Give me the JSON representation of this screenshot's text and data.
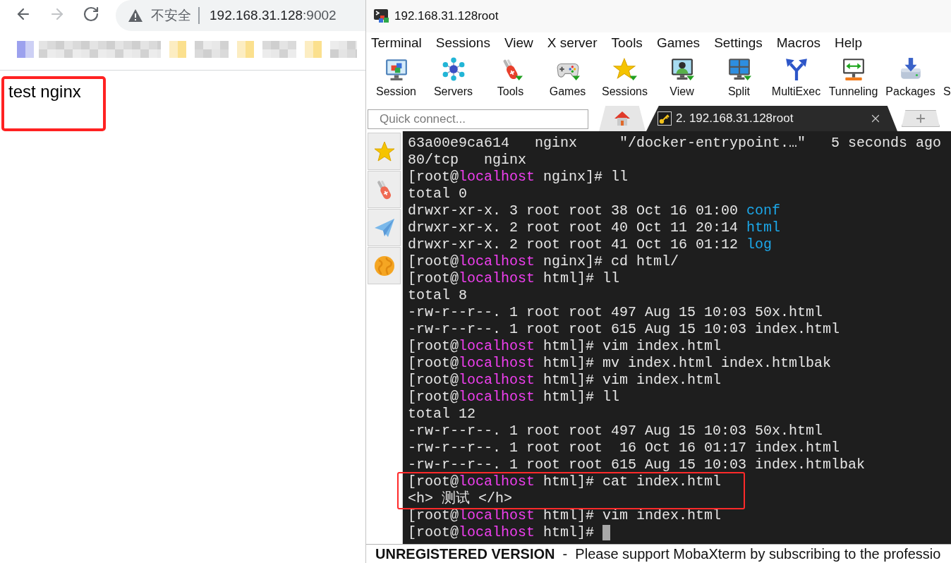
{
  "browser": {
    "nav_buttons": [
      {
        "disabled": false
      },
      {
        "disabled": true
      },
      {
        "disabled": false
      }
    ],
    "address_bar": {
      "security_label": "不安全",
      "host": "192.168.31.128",
      "port": ":9002"
    },
    "page": {
      "text": "test nginx"
    }
  },
  "terminal_app": {
    "window": {
      "title": "192.168.31.128root"
    },
    "menu": [
      "Terminal",
      "Sessions",
      "View",
      "X server",
      "Tools",
      "Games",
      "Settings",
      "Macros",
      "Help"
    ],
    "toolbar": [
      {
        "label": "Session"
      },
      {
        "label": "Servers"
      },
      {
        "label": "Tools"
      },
      {
        "label": "Games"
      },
      {
        "label": "Sessions"
      },
      {
        "label": "View"
      },
      {
        "label": "Split"
      },
      {
        "label": "MultiExec"
      },
      {
        "label": "Tunneling"
      },
      {
        "label": "Packages"
      },
      {
        "label": "S"
      }
    ],
    "quick_connect": {
      "placeholder": "Quick connect..."
    },
    "tabs": [
      {
        "kind": "home",
        "selected": false
      },
      {
        "kind": "session",
        "label": "2. 192.168.31.128root",
        "selected": true
      }
    ],
    "terminal": {
      "cursor": true,
      "lines": [
        [
          {
            "text": "63a00e9ca614   nginx     \"/docker-entrypoint.…\"   5 seconds ago"
          }
        ],
        [
          {
            "text": "80/tcp   nginx"
          }
        ],
        [
          {
            "text": "[root@"
          },
          {
            "text": "localhost",
            "kind": "host"
          },
          {
            "text": " nginx]# ll"
          }
        ],
        [
          {
            "text": "total 0"
          }
        ],
        [
          {
            "text": "drwxr-xr-x. 3 root root 38 Oct 16 01:00 "
          },
          {
            "text": "conf",
            "kind": "dir"
          }
        ],
        [
          {
            "text": "drwxr-xr-x. 2 root root 40 Oct 11 20:14 "
          },
          {
            "text": "html",
            "kind": "dir"
          }
        ],
        [
          {
            "text": "drwxr-xr-x. 2 root root 41 Oct 16 01:12 "
          },
          {
            "text": "log",
            "kind": "dir"
          }
        ],
        [
          {
            "text": "[root@"
          },
          {
            "text": "localhost",
            "kind": "host"
          },
          {
            "text": " nginx]# cd html/"
          }
        ],
        [
          {
            "text": "[root@"
          },
          {
            "text": "localhost",
            "kind": "host"
          },
          {
            "text": " html]# ll"
          }
        ],
        [
          {
            "text": "total 8"
          }
        ],
        [
          {
            "text": "-rw-r--r--. 1 root root 497 Aug 15 10:03 50x.html"
          }
        ],
        [
          {
            "text": "-rw-r--r--. 1 root root 615 Aug 15 10:03 index.html"
          }
        ],
        [
          {
            "text": "[root@"
          },
          {
            "text": "localhost",
            "kind": "host"
          },
          {
            "text": " html]# vim index.html"
          }
        ],
        [
          {
            "text": "[root@"
          },
          {
            "text": "localhost",
            "kind": "host"
          },
          {
            "text": " html]# mv index.html index.htmlbak"
          }
        ],
        [
          {
            "text": "[root@"
          },
          {
            "text": "localhost",
            "kind": "host"
          },
          {
            "text": " html]# vim index.html"
          }
        ],
        [
          {
            "text": "[root@"
          },
          {
            "text": "localhost",
            "kind": "host"
          },
          {
            "text": " html]# ll"
          }
        ],
        [
          {
            "text": "total 12"
          }
        ],
        [
          {
            "text": "-rw-r--r--. 1 root root 497 Aug 15 10:03 50x.html"
          }
        ],
        [
          {
            "text": "-rw-r--r--. 1 root root  16 Oct 16 01:17 index.html"
          }
        ],
        [
          {
            "text": "-rw-r--r--. 1 root root 615 Aug 15 10:03 index.htmlbak"
          }
        ],
        [
          {
            "text": "[root@"
          },
          {
            "text": "localhost",
            "kind": "host"
          },
          {
            "text": " html]# cat index.html"
          }
        ],
        [
          {
            "text": "<h> 测试 </h>"
          }
        ],
        [
          {
            "text": "[root@"
          },
          {
            "text": "localhost",
            "kind": "host"
          },
          {
            "text": " html]# vim index.html"
          }
        ],
        [
          {
            "text": "[root@"
          },
          {
            "text": "localhost",
            "kind": "host"
          },
          {
            "text": " html]# "
          }
        ]
      ]
    },
    "status_bar": {
      "text": "**UNREGISTERED VERSION**  -  Please support MobaXterm by subscribing to the professio"
    }
  }
}
